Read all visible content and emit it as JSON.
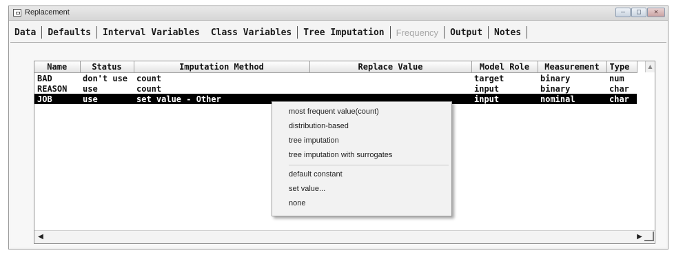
{
  "window": {
    "title": "Replacement",
    "controls": [
      "—",
      "□",
      "✕"
    ]
  },
  "tabs": [
    {
      "label": "Data",
      "disabled": false
    },
    {
      "label": "Defaults",
      "disabled": false
    },
    {
      "label": "Interval Variables",
      "disabled": false
    },
    {
      "label": "Class Variables",
      "disabled": false
    },
    {
      "label": "Tree Imputation",
      "disabled": false
    },
    {
      "label": "Frequency",
      "disabled": true
    },
    {
      "label": "Output",
      "disabled": false
    },
    {
      "label": "Notes",
      "disabled": false
    }
  ],
  "table": {
    "columns": [
      "Name",
      "Status",
      "Imputation Method",
      "Replace Value",
      "Model Role",
      "Measurement",
      "Type"
    ],
    "rows": [
      [
        "BAD",
        "don't use",
        "count",
        "",
        "target",
        "binary",
        "num"
      ],
      [
        "REASON",
        "use",
        "count",
        "",
        "input",
        "binary",
        "char"
      ],
      [
        "JOB",
        "use",
        "set value - Other",
        "",
        "input",
        "nominal",
        "char"
      ]
    ],
    "selected_row": 2
  },
  "context_menu": {
    "items": [
      "most frequent value(count)",
      "distribution-based",
      "tree imputation",
      "tree imputation with surrogates",
      "default constant",
      "set value...",
      "none"
    ],
    "divider_after": 3
  },
  "colors": {
    "selection_bg": "#000000",
    "selection_fg": "#ffffff",
    "disabled_tab": "#a8a8a8"
  }
}
